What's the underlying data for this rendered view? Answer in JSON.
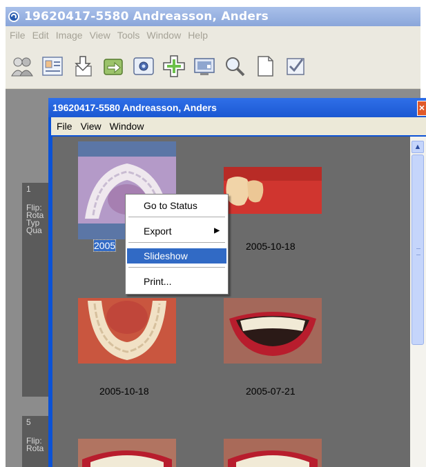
{
  "main_window": {
    "title": "19620417-5580 Andreasson, Anders",
    "menu": [
      "File",
      "Edit",
      "Image",
      "View",
      "Tools",
      "Window",
      "Help"
    ],
    "toolbar_icons": [
      "patients-icon",
      "patient-card-icon",
      "import-icon",
      "export-icon",
      "camera-icon",
      "add-icon",
      "monitor-icon",
      "zoom-icon",
      "document-icon",
      "check-icon"
    ]
  },
  "side_panels": [
    {
      "number": "1",
      "lines": [
        "Flip:",
        "Rota",
        "Typ",
        "Qua"
      ]
    },
    {
      "number": "5",
      "lines": [
        "Flip:",
        "Rota"
      ]
    }
  ],
  "child_window": {
    "title": "19620417-5580 Andreasson, Anders",
    "close_label": "×",
    "menu": [
      "File",
      "View",
      "Window"
    ],
    "thumbnails": [
      {
        "date": "2005",
        "kind": "upper-arch",
        "selected": true
      },
      {
        "date": "2005-10-18",
        "kind": "molar"
      },
      {
        "date": "2005-10-18",
        "kind": "lower-arch"
      },
      {
        "date": "2005-07-21",
        "kind": "smile"
      },
      {
        "date": "",
        "kind": "smile"
      },
      {
        "date": "",
        "kind": "smile"
      }
    ]
  },
  "context_menu": {
    "items": [
      {
        "label": "Go to Status"
      },
      {
        "label": "Export",
        "submenu": true
      },
      {
        "label": "Slideshow",
        "highlighted": true
      },
      {
        "label": "Print..."
      }
    ]
  },
  "colors": {
    "title_bar": "#8aa6da",
    "child_title": "#1b58d2",
    "highlight": "#316ac5",
    "workspace": "#8c8c8c",
    "thumb_area": "#6b6b6b"
  }
}
